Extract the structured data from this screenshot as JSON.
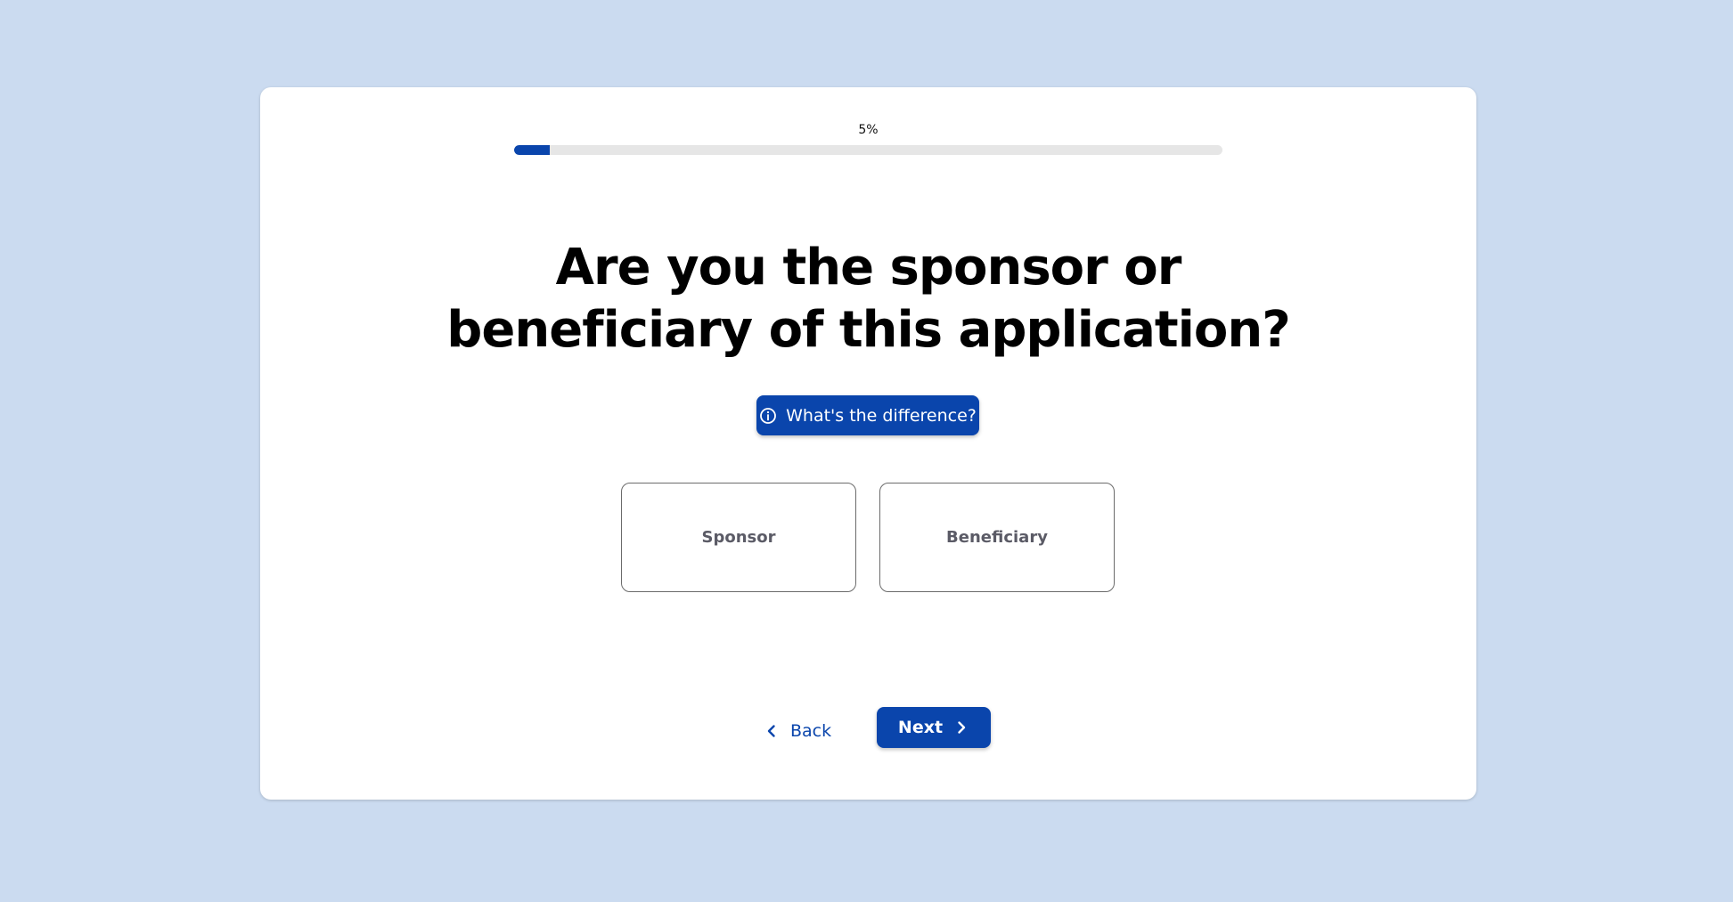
{
  "colors": {
    "page_background": "#cbdbf0",
    "accent": "#0a45ac",
    "track": "#e6e6e6"
  },
  "progress": {
    "label": "5%",
    "value": 0.05
  },
  "question": {
    "title": "Are you the sponsor or beneficiary of this application?"
  },
  "info": {
    "label": "What's the difference?",
    "icon": "info-icon"
  },
  "options": [
    {
      "label": "Sponsor"
    },
    {
      "label": "Beneficiary"
    }
  ],
  "nav": {
    "back_label": "Back",
    "back_icon": "chevron-left-icon",
    "next_label": "Next",
    "next_icon": "chevron-right-icon"
  }
}
